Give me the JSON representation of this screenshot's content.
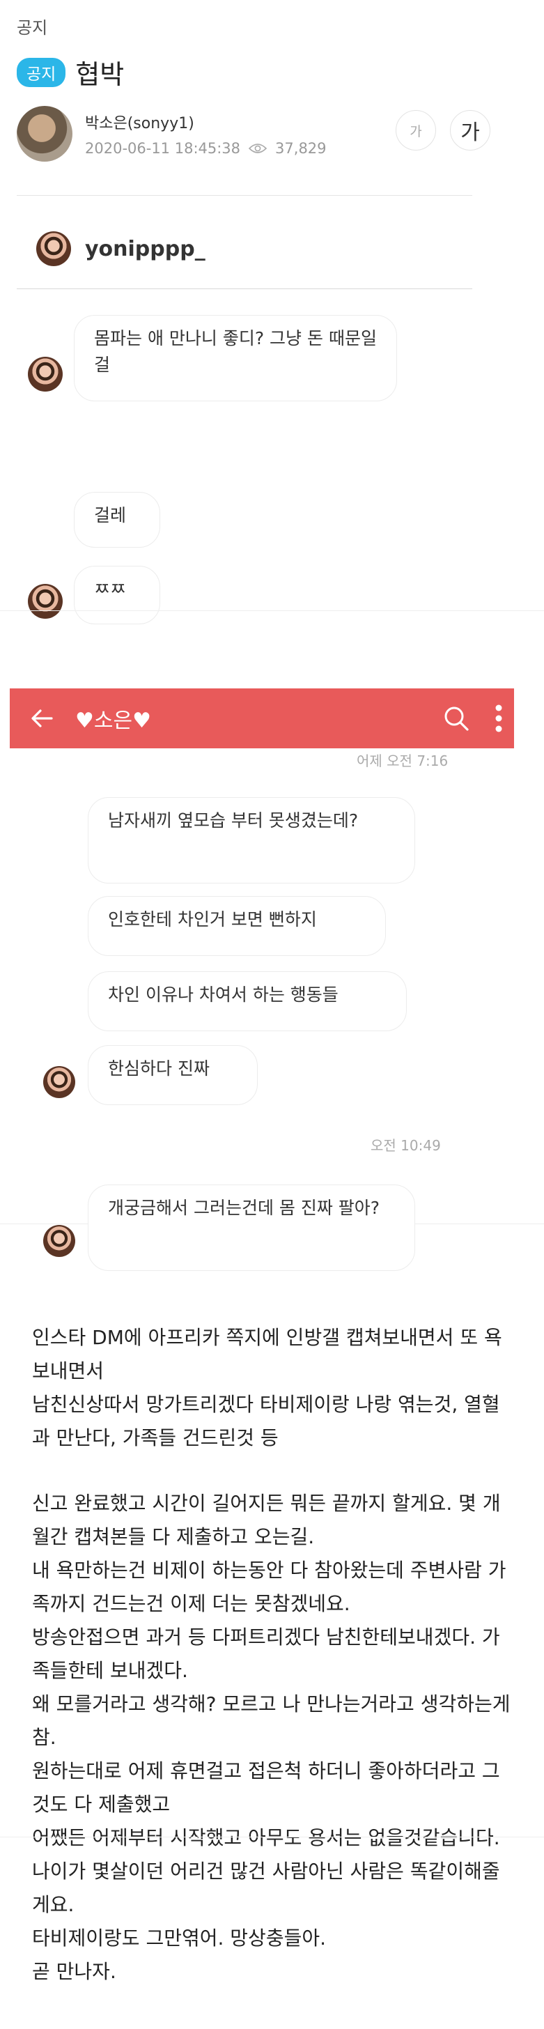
{
  "post": {
    "category": "공지",
    "badge": "공지",
    "title": "협박",
    "author": "박소은(sonyy1)",
    "date": "2020-06-11 18:45:38",
    "views": "37,829",
    "font_small": "가",
    "font_large": "가"
  },
  "dm1": {
    "username": "yonipppp_",
    "messages": [
      "몸파는 애 만나니 좋디? 그냥 돈 때문일걸",
      "걸레",
      "ㅉㅉ"
    ]
  },
  "dm2": {
    "contact": "♥소은♥",
    "time_yesterday": "어제 오전 7:16",
    "messages": [
      "남자새끼 옆모습 부터 못생겼는데?",
      "인호한테 차인거 보면 뻔하지",
      "차인 이유나 차여서 하는 행동들",
      "한심하다 진짜"
    ],
    "time_today": "오전 10:49",
    "last_message": "개궁금해서 그러는건데 몸 진짜 팔아?"
  },
  "body": {
    "paragraph1": [
      "인스타 DM에 아프리카 쪽지에 인방갤 캡쳐보내면서 또 욕보내면서",
      "남친신상따서 망가트리겠다 타비제이랑 나랑 엮는것, 열혈과 만난다, 가족들 건드린것 등"
    ],
    "paragraph2": [
      "신고 완료했고 시간이 길어지든 뭐든 끝까지 할게요. 몇 개월간 캡쳐본들 다 제출하고 오는길.",
      "내 욕만하는건 비제이 하는동안 다 참아왔는데 주변사람 가족까지 건드는건 이제 더는 못참겠네요.",
      "방송안접으면 과거 등 다퍼트리겠다 남친한테보내겠다. 가족들한테 보내겠다.",
      "왜 모를거라고 생각해? 모르고 나 만나는거라고 생각하는게 참.",
      "원하는대로 어제 휴면걸고 접은척 하더니 좋아하더라고 그것도 다 제출했고",
      "어쨌든 어제부터 시작했고 아무도 용서는 없을것같습니다. 나이가 몇살이던 어리건 많건 사람아닌 사람은 똑같이해줄게요.",
      "타비제이랑도 그만엮어. 망상충들아.",
      "곧 만나자."
    ]
  },
  "colors": {
    "badge": "#2bb6e8",
    "chat_bar": "#e85a5a"
  }
}
